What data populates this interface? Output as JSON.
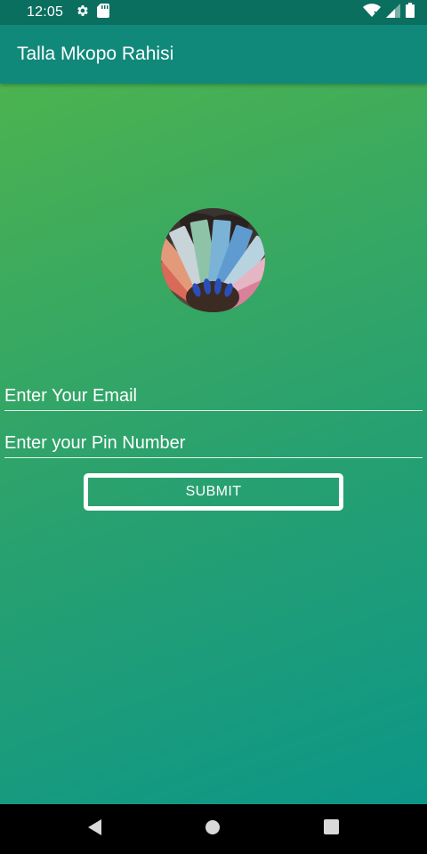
{
  "status_bar": {
    "time": "12:05",
    "left_icons": [
      "gear-icon",
      "sd-card-icon"
    ],
    "right_icons": [
      "wifi-icon",
      "signal-icon",
      "battery-icon"
    ]
  },
  "app_bar": {
    "title": "Talla Mkopo Rahisi"
  },
  "form": {
    "email_placeholder": "Enter Your Email",
    "email_value": "",
    "pin_placeholder": "Enter your Pin Number",
    "pin_value": "",
    "submit_label": "SUBMIT"
  },
  "nav_bar": {
    "buttons": [
      "back-icon",
      "home-icon",
      "recents-icon"
    ]
  },
  "colors": {
    "status_bar": "#0b6f60",
    "app_bar": "#10897a",
    "gradient_start": "#4cb34f",
    "gradient_end": "#0c9688"
  }
}
